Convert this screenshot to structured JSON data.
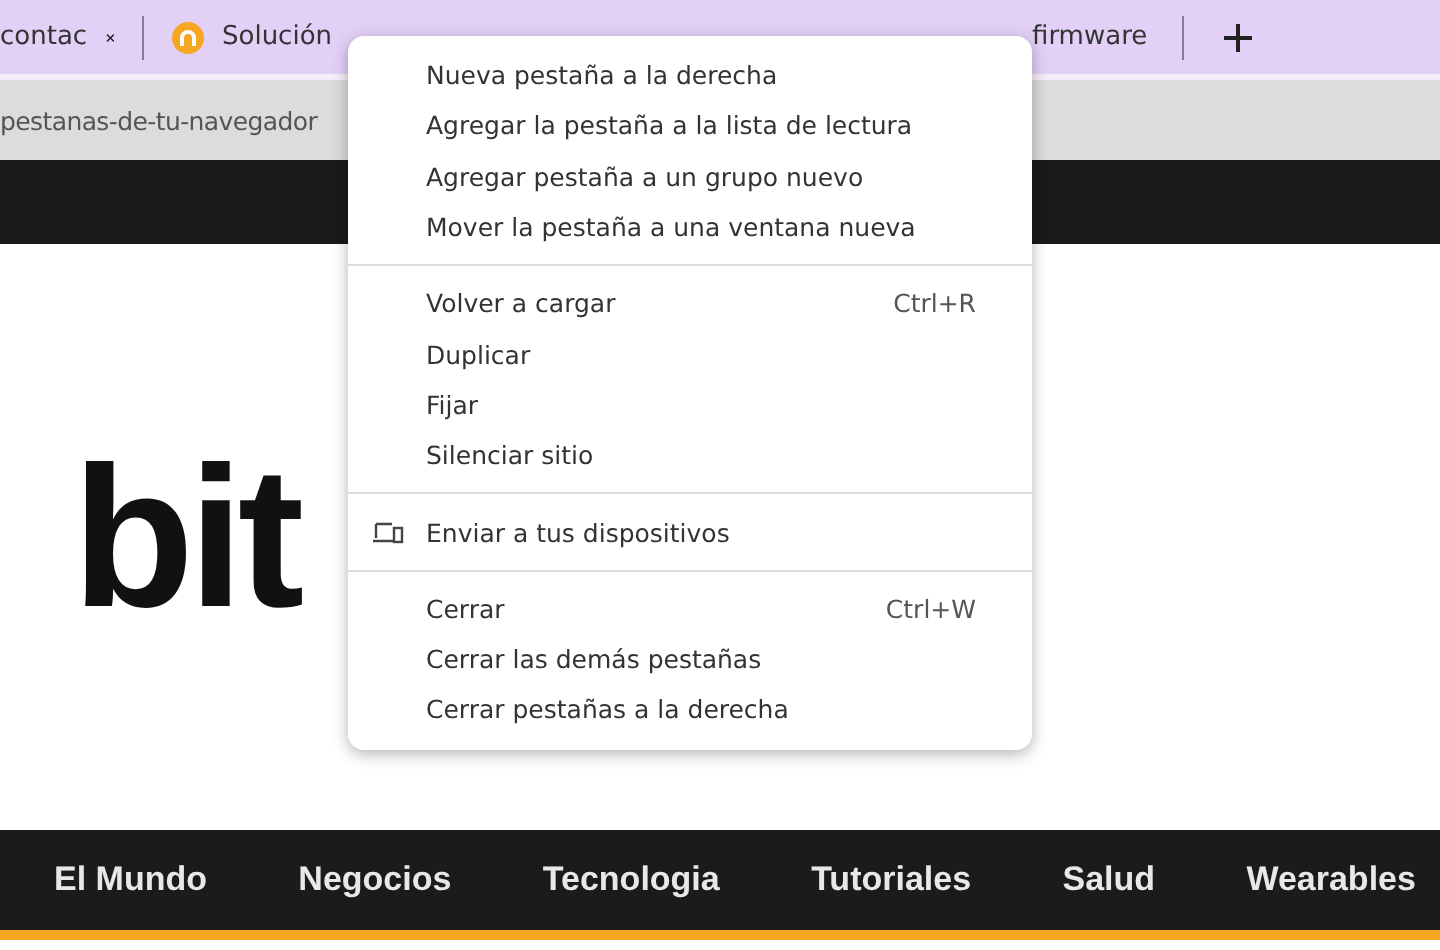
{
  "tabs": [
    {
      "title": "contac",
      "selected": false
    },
    {
      "title": "Solución",
      "selected": false
    },
    {
      "title": "firmware",
      "selected": false
    }
  ],
  "address": "pestanas-de-tu-navegador",
  "logo": "bit",
  "nav": [
    "El Mundo",
    "Negocios",
    "Tecnologia",
    "Tutoriales",
    "Salud",
    "Wearables"
  ],
  "menu": [
    [
      {
        "label": "Nueva pestaña a la derecha"
      },
      {
        "label": "Agregar la pestaña a la lista de lectura"
      },
      {
        "label": "Agregar pestaña a un grupo nuevo"
      },
      {
        "label": "Mover la pestaña a una ventana nueva"
      }
    ],
    [
      {
        "label": "Volver a cargar",
        "shortcut": "Ctrl+R"
      },
      {
        "label": "Duplicar"
      },
      {
        "label": "Fijar"
      },
      {
        "label": "Silenciar sitio"
      }
    ],
    [
      {
        "label": "Enviar a tus dispositivos",
        "kind": "devices"
      }
    ],
    [
      {
        "label": "Cerrar",
        "shortcut": "Ctrl+W"
      },
      {
        "label": "Cerrar las demás pestañas"
      },
      {
        "label": "Cerrar pestañas a la derecha"
      }
    ]
  ]
}
